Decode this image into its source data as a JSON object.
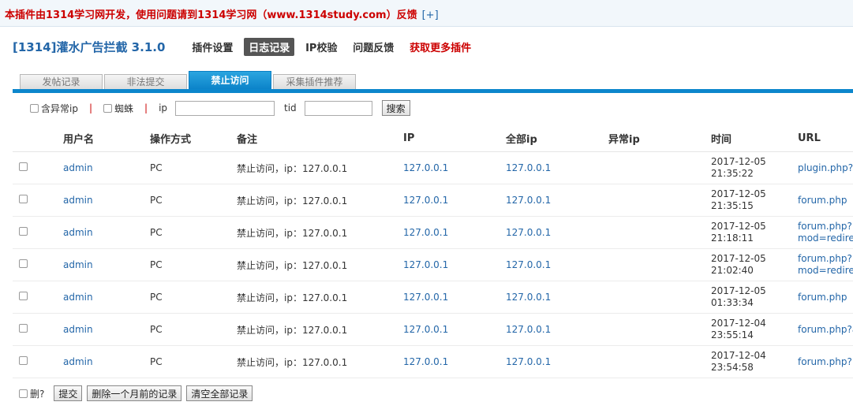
{
  "notice": {
    "text": "本插件由1314学习网开发，使用问题请到1314学习网（www.1314study.com）反馈",
    "expand": "[+]"
  },
  "plugin_title": "[1314]灌水广告拦截 3.1.0",
  "topnav": [
    {
      "label": "插件设置"
    },
    {
      "label": "日志记录",
      "active": true
    },
    {
      "label": "IP校验"
    },
    {
      "label": "问题反馈"
    },
    {
      "label": "获取更多插件",
      "color": "#cc0000"
    }
  ],
  "tabs": [
    {
      "label": "发帖记录"
    },
    {
      "label": "非法提交"
    },
    {
      "label": "禁止访问",
      "active": true
    },
    {
      "label": "采集插件推荐"
    }
  ],
  "filters": {
    "abnormal_ip_label": "含异常ip",
    "spider_label": "蜘蛛",
    "ip_label": "ip",
    "ip_value": "",
    "tid_label": "tid",
    "tid_value": "",
    "search_button": "搜索"
  },
  "table": {
    "headers": [
      "用户名",
      "操作方式",
      "备注",
      "IP",
      "全部ip",
      "异常ip",
      "时间",
      "URL"
    ],
    "rows": [
      {
        "user": "admin",
        "method": "PC",
        "note": "禁止访问，ip：127.0.0.1",
        "ip": "127.0.0.1",
        "all_ip": "127.0.0.1",
        "abnormal_ip": "",
        "date": "2017-12-05",
        "time": "21:35:22",
        "url": "plugin.php?i"
      },
      {
        "user": "admin",
        "method": "PC",
        "note": "禁止访问，ip：127.0.0.1",
        "ip": "127.0.0.1",
        "all_ip": "127.0.0.1",
        "abnormal_ip": "",
        "date": "2017-12-05",
        "time": "21:35:15",
        "url": "forum.php"
      },
      {
        "user": "admin",
        "method": "PC",
        "note": "禁止访问，ip：127.0.0.1",
        "ip": "127.0.0.1",
        "all_ip": "127.0.0.1",
        "abnormal_ip": "",
        "date": "2017-12-05",
        "time": "21:18:11",
        "url": "forum.php? mod=redire"
      },
      {
        "user": "admin",
        "method": "PC",
        "note": "禁止访问，ip：127.0.0.1",
        "ip": "127.0.0.1",
        "all_ip": "127.0.0.1",
        "abnormal_ip": "",
        "date": "2017-12-05",
        "time": "21:02:40",
        "url": "forum.php? mod=redire"
      },
      {
        "user": "admin",
        "method": "PC",
        "note": "禁止访问，ip：127.0.0.1",
        "ip": "127.0.0.1",
        "all_ip": "127.0.0.1",
        "abnormal_ip": "",
        "date": "2017-12-05",
        "time": "01:33:34",
        "url": "forum.php"
      },
      {
        "user": "admin",
        "method": "PC",
        "note": "禁止访问，ip：127.0.0.1",
        "ip": "127.0.0.1",
        "all_ip": "127.0.0.1",
        "abnormal_ip": "",
        "date": "2017-12-04",
        "time": "23:55:14",
        "url": "forum.php?a"
      },
      {
        "user": "admin",
        "method": "PC",
        "note": "禁止访问，ip：127.0.0.1",
        "ip": "127.0.0.1",
        "all_ip": "127.0.0.1",
        "abnormal_ip": "",
        "date": "2017-12-04",
        "time": "23:54:58",
        "url": "forum.php?"
      }
    ]
  },
  "footer": {
    "delete_label": "删?",
    "submit_button": "提交",
    "delete_month_button": "删除一个月前的记录",
    "clear_all_button": "清空全部记录"
  },
  "colors": {
    "accent": "#0c86cc",
    "link": "#2366a8",
    "warning": "#cc0000"
  }
}
